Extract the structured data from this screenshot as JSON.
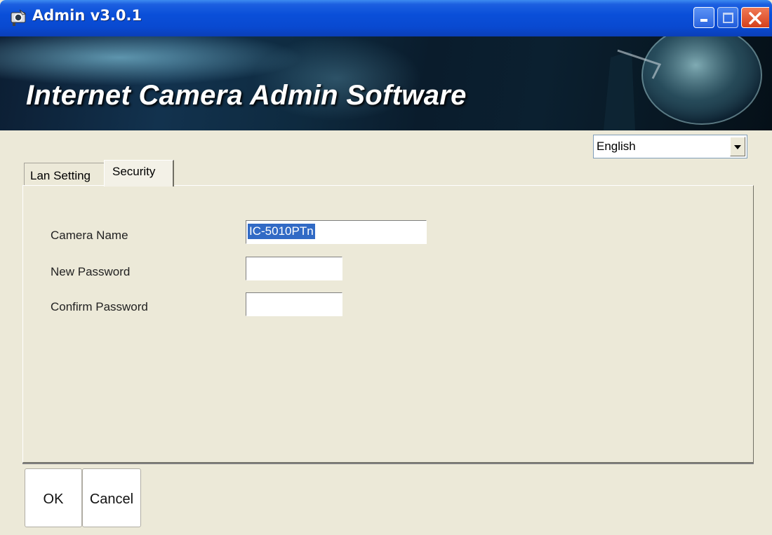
{
  "window": {
    "title": "Admin v3.0.1",
    "icon": "camera-app-icon",
    "controls": [
      "minimize-icon",
      "maximize-icon",
      "close-icon"
    ]
  },
  "banner": {
    "title": "Internet Camera Admin Software"
  },
  "language": {
    "selected": "English"
  },
  "tabs": [
    {
      "label": "Lan Setting",
      "active": false
    },
    {
      "label": "Security",
      "active": true
    }
  ],
  "security": {
    "camera_name_label": "Camera Name",
    "camera_name_value": "IC-5010PTn",
    "new_password_label": "New Password",
    "new_password_value": "",
    "confirm_password_label": "Confirm Password",
    "confirm_password_value": ""
  },
  "buttons": {
    "ok": "OK",
    "cancel": "Cancel"
  },
  "colors": {
    "titlebar": "#0A4FD9",
    "dialog_bg": "#ECE9D8",
    "selection": "#316AC5",
    "close_button": "#D5401C"
  }
}
